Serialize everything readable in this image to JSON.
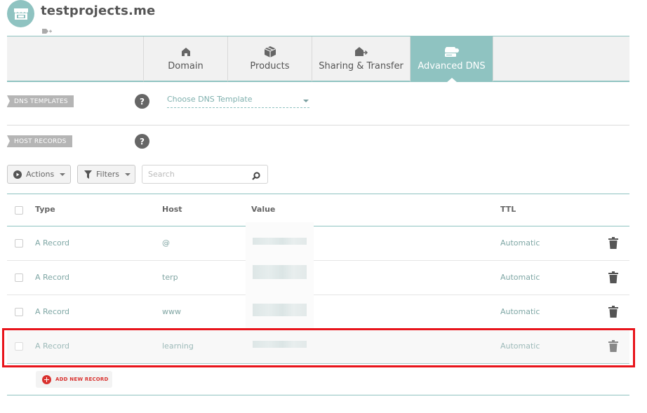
{
  "header": {
    "site_title": "testprojects.me",
    "avatar_icon": "storefront-icon",
    "tag_icon": "tag-plus-icon"
  },
  "tabs": [
    {
      "label": "Domain",
      "icon": "home-icon",
      "active": false
    },
    {
      "label": "Products",
      "icon": "box-icon",
      "active": false
    },
    {
      "label": "Sharing & Transfer",
      "icon": "house-arrow-icon",
      "active": false
    },
    {
      "label": "Advanced DNS",
      "icon": "server-icon",
      "active": true
    }
  ],
  "dns_templates": {
    "section_label": "DNS TEMPLATES",
    "help": "?",
    "select_value": "Choose DNS Template"
  },
  "host_records": {
    "section_label": "HOST RECORDS",
    "help": "?"
  },
  "toolbar": {
    "actions_label": "Actions",
    "filters_label": "Filters",
    "search_placeholder": "Search"
  },
  "table": {
    "columns": [
      "Type",
      "Host",
      "Value",
      "TTL"
    ],
    "rows": [
      {
        "type": "A Record",
        "host": "@",
        "value": "",
        "ttl": "Automatic"
      },
      {
        "type": "A Record",
        "host": "terp",
        "value": "",
        "ttl": "Automatic"
      },
      {
        "type": "A Record",
        "host": "www",
        "value": "",
        "ttl": "Automatic"
      },
      {
        "type": "A Record",
        "host": "learning",
        "value": "",
        "ttl": "Automatic",
        "highlighted": true
      }
    ]
  },
  "add_record_label": "ADD NEW RECORD",
  "colors": {
    "accent": "#8fc3c1",
    "danger": "#d9322f",
    "highlight_box": "#e8141b"
  }
}
